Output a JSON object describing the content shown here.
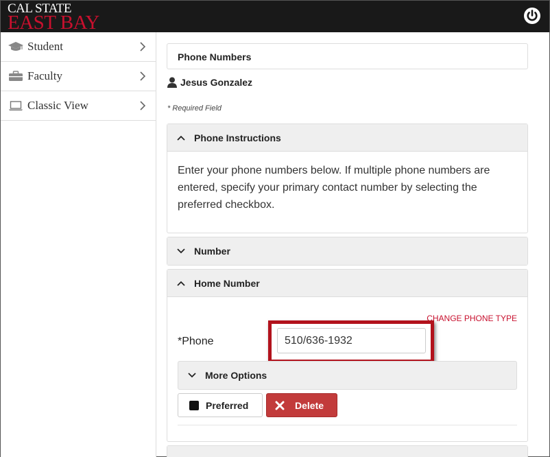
{
  "header": {
    "logo_line1": "CAL STATE",
    "logo_line2": "EAST BAY",
    "power_icon": "power-icon"
  },
  "sidebar": {
    "items": [
      {
        "label": "Student",
        "icon": "graduation-cap-icon"
      },
      {
        "label": "Faculty",
        "icon": "briefcase-icon"
      },
      {
        "label": "Classic View",
        "icon": "laptop-icon"
      }
    ]
  },
  "main": {
    "page_title": "Phone Numbers",
    "user_name": "Jesus Gonzalez",
    "required_note": "* Required Field",
    "instructions": {
      "title": "Phone Instructions",
      "text": "Enter your phone numbers below. If multiple phone numbers are entered, specify your primary contact number by selecting the preferred checkbox."
    },
    "number_panel": {
      "title": "Number"
    },
    "home_panel": {
      "title": "Home Number",
      "change_type": "CHANGE PHONE TYPE",
      "phone_label": "*Phone",
      "phone_value": "510/636-1932",
      "more_options": "More Options",
      "preferred_label": "Preferred",
      "delete_label": "Delete"
    }
  },
  "colors": {
    "brand_red": "#c8102e",
    "delete_red": "#c23b3b",
    "highlight_red": "#b2121c",
    "topbar": "#191919"
  }
}
